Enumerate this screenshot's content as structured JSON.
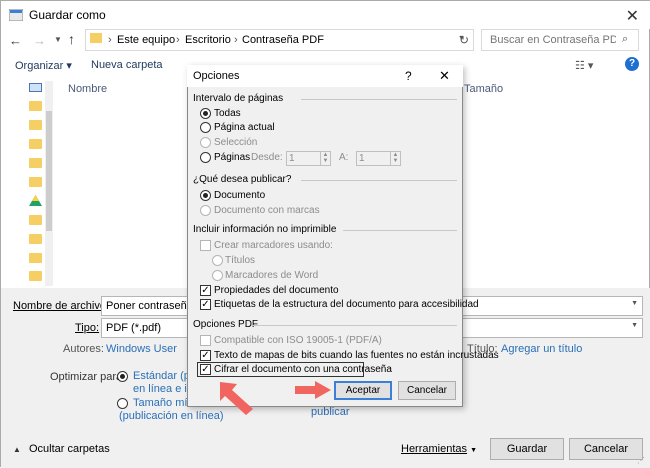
{
  "window": {
    "title": "Guardar como"
  },
  "address": {
    "crumbs": [
      "Este equipo",
      "Escritorio",
      "Contraseña PDF"
    ]
  },
  "search": {
    "placeholder": "Buscar en Contraseña PDF"
  },
  "toolbar": {
    "organize": "Organizar",
    "new_folder": "Nueva carpeta"
  },
  "columns": {
    "name": "Nombre",
    "size": "Tamaño"
  },
  "file": {
    "name_label": "Nombre de archivo:",
    "name_value": "Poner contraseña a",
    "type_label": "Tipo:",
    "type_value": "PDF (*.pdf)",
    "authors_label": "Autores:",
    "authors_value": "Windows User",
    "title_label": "Título:",
    "title_value": "Agregar un título"
  },
  "optimize": {
    "label": "Optimizar para:",
    "standard_line1": "Estándar (publ",
    "standard_line2": "en línea e imp",
    "min_line1": "Tamaño mínim",
    "min_line2": "(publicación en línea)",
    "publish_fragment": "publicar"
  },
  "footer": {
    "hide_folders": "Ocultar carpetas",
    "tools": "Herramientas",
    "save": "Guardar",
    "cancel": "Cancelar"
  },
  "dialog": {
    "title": "Opciones",
    "help": "?",
    "page_range": {
      "heading": "Intervalo de páginas",
      "all": "Todas",
      "current": "Página actual",
      "selection": "Selección",
      "pages": "Páginas",
      "from_label": "Desde:",
      "from_value": "1",
      "to_label": "A:",
      "to_value": "1"
    },
    "publish": {
      "heading": "¿Qué desea publicar?",
      "document": "Documento",
      "document_markup": "Documento con marcas"
    },
    "non_printing": {
      "heading": "Incluir información no imprimible",
      "bookmarks": "Crear marcadores usando:",
      "headings": "Títulos",
      "word_bookmarks": "Marcadores de Word",
      "properties": "Propiedades del documento",
      "structure_tags": "Etiquetas de la estructura del documento para accesibilidad"
    },
    "pdf_options": {
      "heading": "Opciones PDF",
      "iso": "Compatible con ISO 19005-1 (PDF/A)",
      "bitmap": "Texto de mapas de bits cuando las fuentes no están incrustadas",
      "encrypt": "Cifrar el documento con una contraseña"
    },
    "ok": "Aceptar",
    "cancel": "Cancelar"
  },
  "colors": {
    "accent": "#3c7fd6",
    "arrow": "#f0655f",
    "link": "#2a6fb8"
  }
}
